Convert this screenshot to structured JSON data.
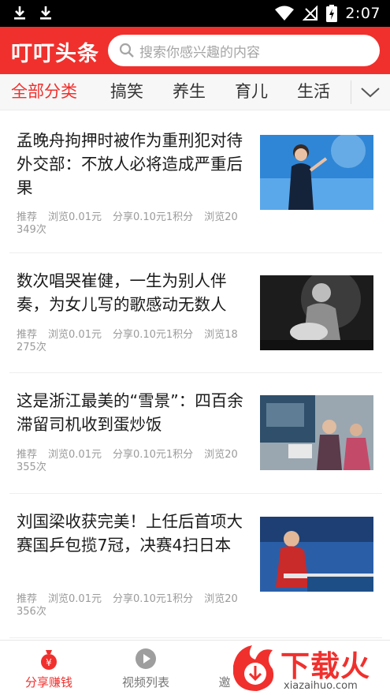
{
  "status_bar": {
    "time": "2:07",
    "icons": [
      "download-icon",
      "download-icon",
      "wifi-icon",
      "no-signal-icon",
      "battery-charging-icon"
    ]
  },
  "header": {
    "app_title": "叮叮头条",
    "search": {
      "placeholder": "搜索你感兴趣的内容",
      "icon": "search-icon"
    }
  },
  "tabs": {
    "items": [
      {
        "label": "全部分类",
        "active": true
      },
      {
        "label": "搞笑",
        "active": false
      },
      {
        "label": "养生",
        "active": false
      },
      {
        "label": "育儿",
        "active": false
      },
      {
        "label": "生活",
        "active": false
      }
    ],
    "more_icon": "chevron-down-icon"
  },
  "news": [
    {
      "title": "孟晚舟拘押时被作为重刑犯对待 外交部：不放人必将造成严重后果",
      "tag": "推荐",
      "view_reward": "浏览0.01元",
      "share_reward": "分享0.10元1积分",
      "views": "浏览20349次"
    },
    {
      "title": "数次唱哭崔健，一生为别人伴奏，为女儿写的歌感动无数人",
      "tag": "推荐",
      "view_reward": "浏览0.01元",
      "share_reward": "分享0.10元1积分",
      "views": "浏览18275次"
    },
    {
      "title": "这是浙江最美的“雪景”：四百余滞留司机收到蛋炒饭",
      "tag": "推荐",
      "view_reward": "浏览0.01元",
      "share_reward": "分享0.10元1积分",
      "views": "浏览20355次"
    },
    {
      "title": "刘国梁收获完美！上任后首项大赛国乒包揽7冠，决赛4扫日本",
      "tag": "推荐",
      "view_reward": "浏览0.01元",
      "share_reward": "分享0.10元1积分",
      "views": "浏览20356次"
    }
  ],
  "bottom_nav": {
    "items": [
      {
        "label": "分享赚钱",
        "icon": "money-bag-icon",
        "active": true
      },
      {
        "label": "视频列表",
        "icon": "play-circle-icon",
        "active": false
      },
      {
        "label": "邀",
        "icon": "invite-icon",
        "active": false
      }
    ]
  },
  "watermark": {
    "brand": "下载火",
    "url": "xiazaihuo.com"
  },
  "colors": {
    "accent": "#f0302d",
    "text": "#1a1a1a",
    "meta": "#9a9a9a"
  }
}
